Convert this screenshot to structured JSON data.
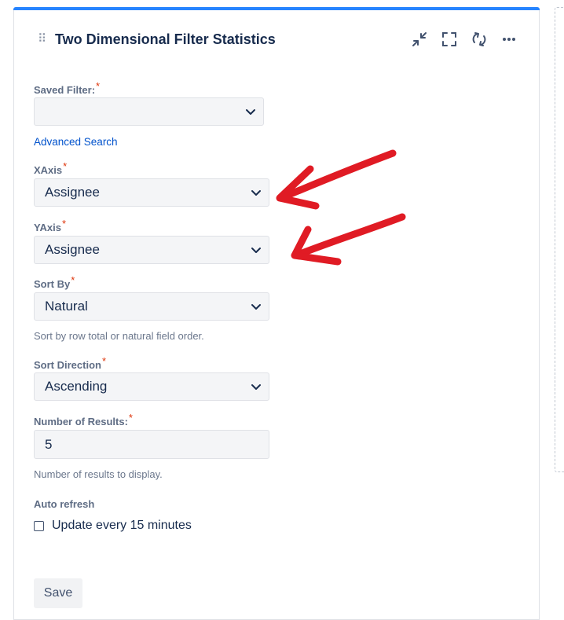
{
  "gadget": {
    "title": "Two Dimensional Filter Statistics",
    "drag_handle": "⠿"
  },
  "header_icons": [
    "minimize-icon",
    "maximize-icon",
    "refresh-icon",
    "more-icon"
  ],
  "form": {
    "saved_filter": {
      "label": "Saved Filter:",
      "required": "*",
      "value": ""
    },
    "advanced_search": "Advanced Search",
    "xaxis": {
      "label": "XAxis",
      "required": "*",
      "value": "Assignee"
    },
    "yaxis": {
      "label": "YAxis",
      "required": "*",
      "value": "Assignee"
    },
    "sort_by": {
      "label": "Sort By",
      "required": "*",
      "value": "Natural",
      "help": "Sort by row total or natural field order."
    },
    "sort_direction": {
      "label": "Sort Direction",
      "required": "*",
      "value": "Ascending"
    },
    "num_results": {
      "label": "Number of Results:",
      "required": "*",
      "value": "5",
      "help": "Number of results to display."
    },
    "auto_refresh": {
      "label": "Auto refresh",
      "checkbox_label": "Update every 15 minutes"
    },
    "save_label": "Save"
  },
  "colors": {
    "accent": "#2684ff",
    "link": "#0052cc",
    "required": "#de350b",
    "annotation_arrow": "#e01b24"
  }
}
